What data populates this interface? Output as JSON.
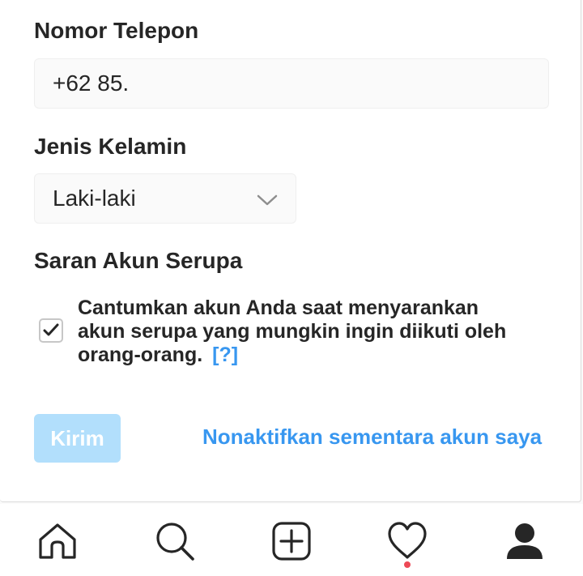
{
  "form": {
    "phone": {
      "label": "Nomor Telepon",
      "value": "+62 85."
    },
    "gender": {
      "label": "Jenis Kelamin",
      "selected": "Laki-laki"
    },
    "similar_accounts": {
      "label": "Saran Akun Serupa",
      "checkbox_checked": true,
      "checkbox_text": "Cantumkan akun Anda saat menyarankan akun serupa yang mungkin ingin diikuti oleh orang-orang.",
      "help_link": "[?]"
    },
    "submit_label": "Kirim",
    "deactivate_label": "Nonaktifkan sementara akun saya"
  },
  "tabbar": {
    "items": [
      {
        "icon": "home-icon"
      },
      {
        "icon": "search-icon"
      },
      {
        "icon": "new-post-icon"
      },
      {
        "icon": "heart-icon",
        "notification": true
      },
      {
        "icon": "profile-icon"
      }
    ]
  },
  "colors": {
    "link": "#3897f0",
    "submit_disabled": "#b2dffc",
    "notification_dot": "#ed4956"
  }
}
